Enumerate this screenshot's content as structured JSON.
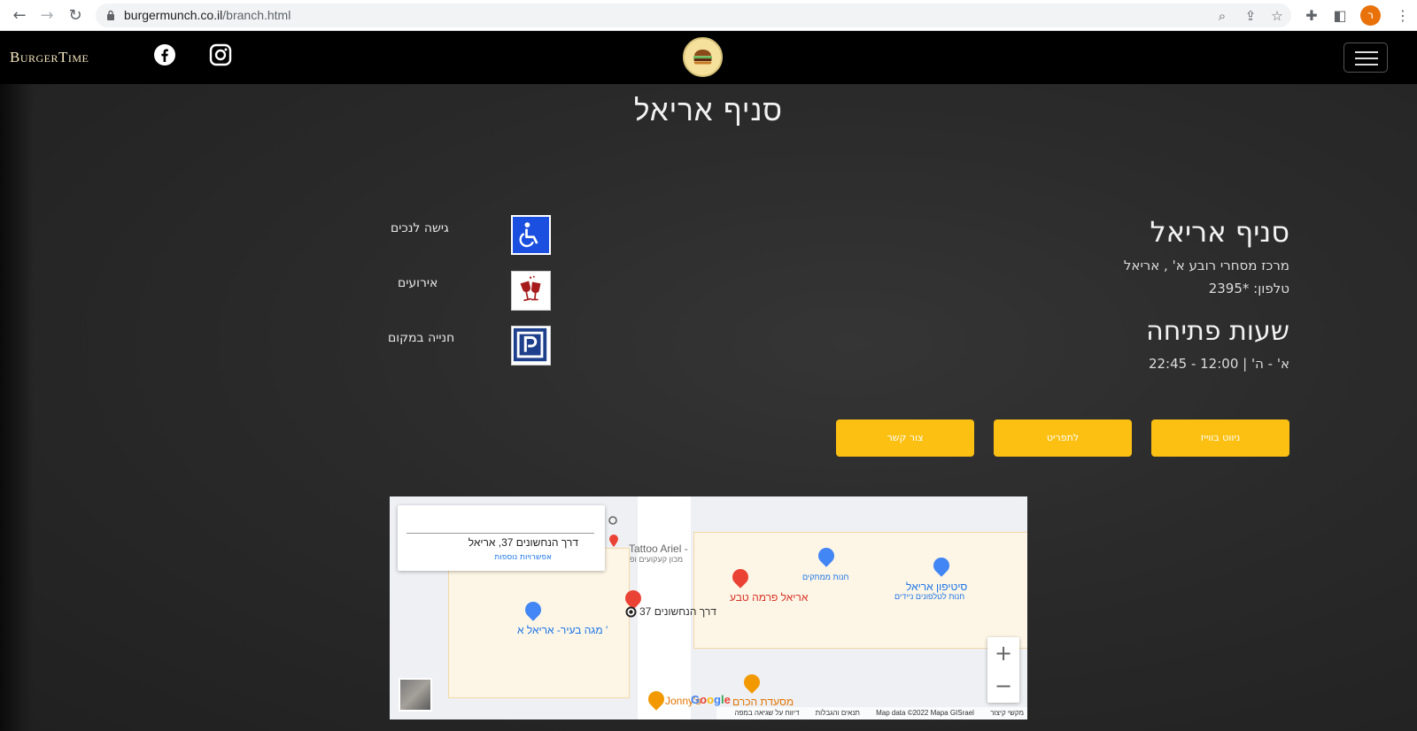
{
  "browser": {
    "url_host": "burgermunch.co.il",
    "url_path": "/branch.html",
    "profile_initial": "ר"
  },
  "site": {
    "brand": "BurgerTime",
    "page_title": "סניף אריאל"
  },
  "branch": {
    "name": "סניף אריאל",
    "address": "מרכז מסחרי רובע א' , אריאל",
    "phone": "טלפון: *2395",
    "hours_title": "שעות פתיחה",
    "hours": "א' - ה' | 12:00 - 22:45"
  },
  "buttons": {
    "directions": "ניווט בווייז",
    "menu": "לתפריט",
    "contact": "צור קשר"
  },
  "features": [
    {
      "label": "גישה לנכים",
      "icon": "wheelchair-icon"
    },
    {
      "label": "אירועים",
      "icon": "wine-glasses-icon"
    },
    {
      "label": "חנייה במקום",
      "icon": "parking-icon"
    }
  ],
  "map": {
    "card_address": "דרך הנחשונים 37, אריאל",
    "card_more": "אפשרויות נוספות",
    "labels": {
      "tattoo": "Tattoo Ariel -",
      "tattoo_sub": "מכון קעקועים ופ",
      "candy": "חנות ממתקים",
      "city_phone": "סיטיפון אריאל",
      "city_phone_sub": "חנות לטלפונים ניידים",
      "pharma": "אריאל פרמה טבע",
      "marker_address": "דרך הנחשונים 37",
      "mega": "מגה בעיר- אריאל א '",
      "restaurant": "מסעדת הכרם",
      "jonnys": "Jonny's"
    },
    "google": "Google",
    "attribution": [
      "מקשי קיצור",
      "Map data ©2022 Mapa GISrael",
      "תנאים והגבלות",
      "דיווח על שגיאה במפה"
    ],
    "zoom_in": "+",
    "zoom_out": "−"
  },
  "colors": {
    "accent": "#fbc012",
    "nav_bg": "#000000",
    "page_bg": "#2a2a2a"
  }
}
